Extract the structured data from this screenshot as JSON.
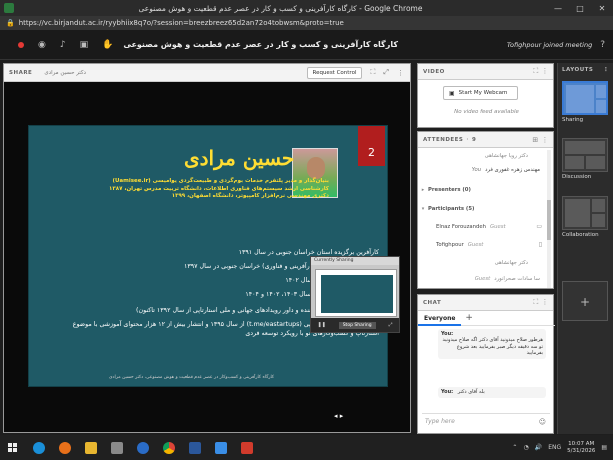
{
  "browser": {
    "title": "کارگاه کارآفرینی و کسب و کار در عصر عدم قطعیت و هوش مصنوعی - Google Chrome",
    "url": "https://vc.birjandut.ac.ir/ryybhiix8q7o/?session=breezbreez65d2an72o4tobwsm&proto=true"
  },
  "meeting": {
    "title": "کارگاه کارآفرینی و کسب و کار در عصر عدم قطعیت و هوش مصنوعی",
    "notice": "Tofighpour joined meeting"
  },
  "share_pod": {
    "title": "SHARE",
    "presenter": "دکتر حسین مرادی",
    "request_control": "Request Control"
  },
  "slide": {
    "name": "حسین مرادی",
    "number": "2",
    "bio_lines": [
      "بنیان‌گذار و مدیر پلتفرم خدمات بوم‌گردی و طبیعت‌گردی یوامیسی (Uamisee.ir)",
      "کارشناسی ارشد سیستم‌های فناوری اطلاعات، دانشگاه تربیت مدرس تهران، ۱۳۸۷",
      "دکتری مهندسی نرم‌افزار کامپیوتر، دانشگاه اصفهان، ۱۳۹۹"
    ],
    "bullets": [
      "کارآفرین برگزیده استان خراسان جنوبی در سال ۱۳۹۱",
      "(پژوهشگر برتر در حوزه کارآفرینی و فناوری) خراسان جنوبی در سال ۱۳۹۷",
      "استان خراسان جنوبی در سال ۱۴۰۲",
      "دانشگاه صنعتی بیرجند در سال ۱۴۰۳، ۱۴۰۲ و ۱۴۰۴",
      "استارتاپی (منتور، برگزار کننده و داور رویدادهای جهانی و ملی استارتاپی از سال ۱۳۹۲ تاکنون)",
      "مدیر رسانه مجازی استارتاپی (t.me/eastartups) از سال ۱۳۹۵ و انتشار بیش از ۱۲ هزار محتوای آموزشی با موضوع استارتاپ و کسب‌وکارهای نو با رویکرد توسعه فردی"
    ],
    "footer": "کارگاه کارآفرینی و کسب‌وکار در عصر عدم قطعیت و هوش مصنوعی، دکتر حسین مرادی"
  },
  "camera_pod": {
    "title": "Currently Sharing",
    "stop_label": "Stop Sharing"
  },
  "video_pod": {
    "title": "VIDEO",
    "start_webcam": "Start My Webcam",
    "no_feed": "No video feed available"
  },
  "attendees": {
    "title": "ATTENDEES",
    "count": "9",
    "rows": [
      {
        "kind": "rtl",
        "text": "دکتر رویا جهانشاهی"
      },
      {
        "kind": "you",
        "text": "مهندس زهره غفوری فرد",
        "tag": "You"
      },
      {
        "kind": "group",
        "text": "Presenters (0)"
      },
      {
        "kind": "group",
        "text": "Participants (5)"
      },
      {
        "kind": "person",
        "text": "Elnaz Forouzandeh",
        "role": "Guest"
      },
      {
        "kind": "person",
        "text": "Tofighpour",
        "role": "Guest"
      },
      {
        "kind": "rtl",
        "text": "دکتر جهانشاهی"
      },
      {
        "kind": "rtl",
        "text": "سا سادات صحرانورد"
      },
      {
        "kind": "person",
        "text": "",
        "role": "Guest"
      }
    ]
  },
  "chat": {
    "title": "CHAT",
    "tab": "Everyone",
    "messages": [
      {
        "from": "You:",
        "text": "هرطور صلاح میدونید آقای دکتر اگه صلاح میدونید تو سه دقیقه دیگر صبر بفرمایید بعد شروع بفرمایید"
      },
      {
        "from": "You:",
        "text": "بله آقای دکتر"
      }
    ],
    "placeholder": "Type here"
  },
  "layouts": {
    "title": "LAYOUTS",
    "items": [
      "Sharing",
      "Discussion",
      "Collaboration"
    ]
  },
  "taskbar": {
    "time": "10:07 AM",
    "date": "5/31/2026",
    "lang": "ENG"
  },
  "colors": {
    "slide_bg": "#1f5a66",
    "accent_blue": "#3a7bd5",
    "record_red": "#e53935"
  }
}
